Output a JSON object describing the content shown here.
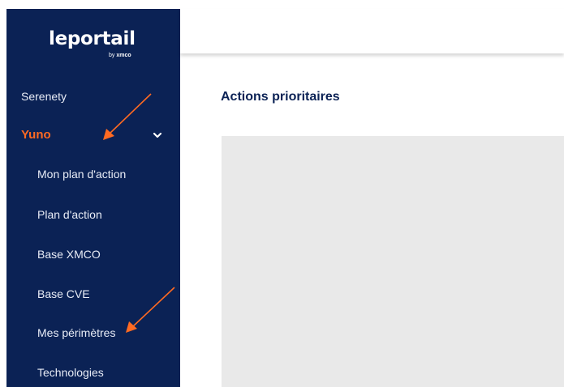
{
  "logo": {
    "word": "leportail",
    "by_prefix": "by",
    "by_brand": "xmco"
  },
  "sidebar": {
    "items": [
      {
        "label": "Serenety"
      },
      {
        "label": "Yuno",
        "expanded": true
      },
      {
        "label": "Mon plan d'action"
      },
      {
        "label": "Plan d'action"
      },
      {
        "label": "Base XMCO"
      },
      {
        "label": "Base CVE"
      },
      {
        "label": "Mes périmètres"
      },
      {
        "label": "Technologies"
      }
    ]
  },
  "main": {
    "title": "Actions prioritaires"
  },
  "colors": {
    "sidebar_bg": "#0b2255",
    "accent": "#ff6a22",
    "panel_bg": "#e9e9e9",
    "title": "#0b2255"
  },
  "annotations": {
    "arrow_color": "#ff6a22",
    "points_to": [
      "Yuno",
      "Mes périmètres"
    ]
  }
}
